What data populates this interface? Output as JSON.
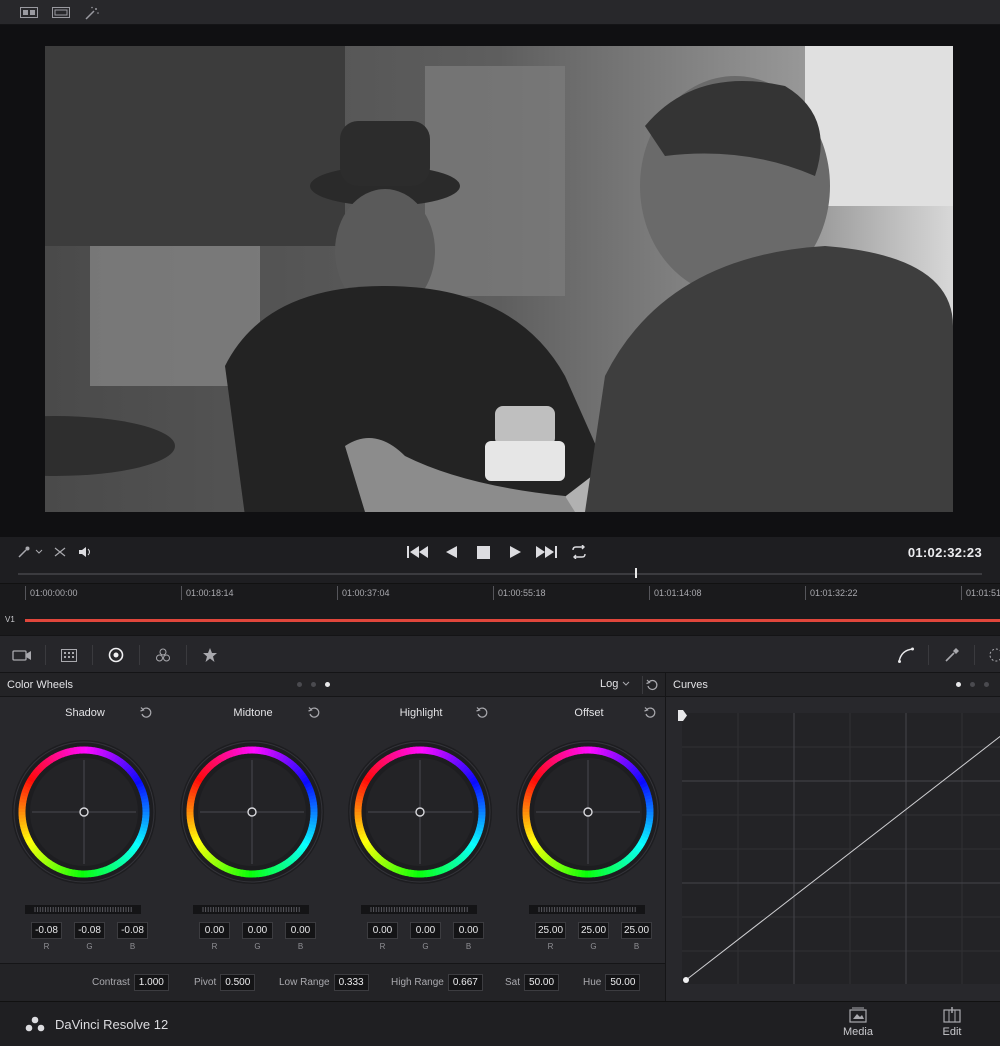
{
  "transport": {
    "timecode": "01:02:32:23",
    "playhead_fraction": 0.64
  },
  "timeline": {
    "ticks": [
      "01:00:00:00",
      "01:00:18:14",
      "01:00:37:04",
      "01:00:55:18",
      "01:01:14:08",
      "01:01:32:22",
      "01:01:51"
    ],
    "track": "V1"
  },
  "color_wheels": {
    "title": "Color Wheels",
    "mode": "Log",
    "wheels": [
      {
        "name": "Shadow",
        "r": "-0.08",
        "g": "-0.08",
        "b": "-0.08"
      },
      {
        "name": "Midtone",
        "r": "0.00",
        "g": "0.00",
        "b": "0.00"
      },
      {
        "name": "Highlight",
        "r": "0.00",
        "g": "0.00",
        "b": "0.00"
      },
      {
        "name": "Offset",
        "r": "25.00",
        "g": "25.00",
        "b": "25.00"
      }
    ],
    "channel_labels": {
      "r": "R",
      "g": "G",
      "b": "B"
    },
    "adjustments": {
      "contrast_label": "Contrast",
      "contrast": "1.000",
      "pivot_label": "Pivot",
      "pivot": "0.500",
      "low_range_label": "Low Range",
      "low_range": "0.333",
      "high_range_label": "High Range",
      "high_range": "0.667",
      "sat_label": "Sat",
      "sat": "50.00",
      "hue_label": "Hue",
      "hue": "50.00"
    }
  },
  "curves": {
    "title": "Curves"
  },
  "footer": {
    "app_name": "DaVinci Resolve 12",
    "pages": [
      "Media",
      "Edit"
    ]
  },
  "colors": {
    "accent_track": "#e0463b",
    "panel_bg": "#28282c"
  }
}
